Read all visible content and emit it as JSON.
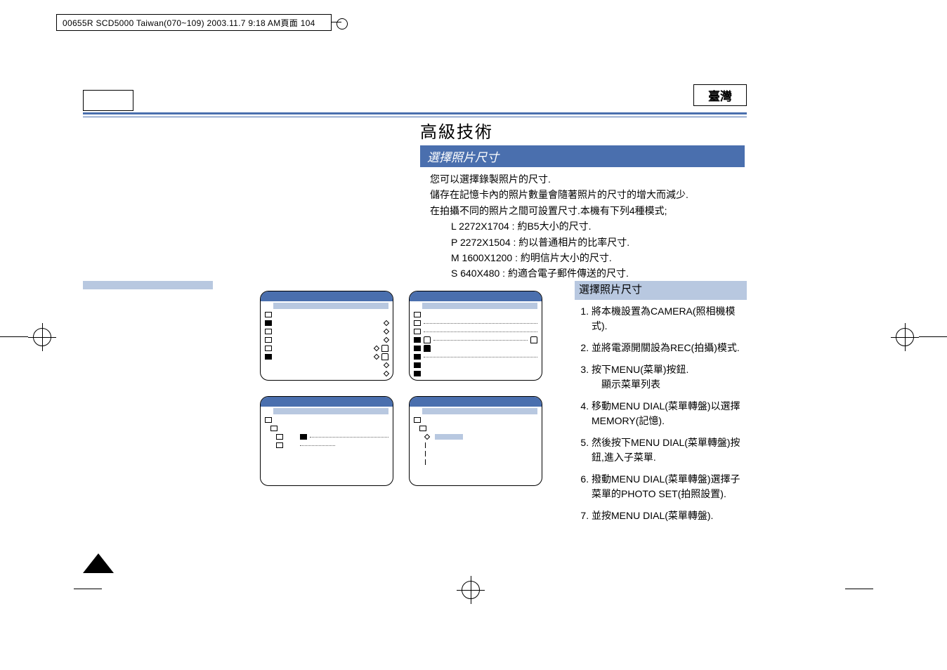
{
  "spine": "00655R SCD5000 Taiwan(070~109)  2003.11.7  9:18 AM頁面 104",
  "language_label": "臺灣",
  "heading": "高級技術",
  "section_title": "選擇照片尺寸",
  "intro": {
    "l1": "您可以選擇錄製照片的尺寸.",
    "l2": "儲存在記憶卡內的照片數量會隨著照片的尺寸的增大而減少.",
    "l3": "在拍攝不同的照片之間可設置尺寸.本機有下列4種模式;",
    "modes": {
      "L": "L 2272X1704 : 約B5大小的尺寸.",
      "P": "P 2272X1504 : 約以普通相片的比率尺寸.",
      "M": "M 1600X1200 : 約明信片大小的尺寸.",
      "S": "S 640X480 : 約適合電子郵件傳送的尺寸."
    }
  },
  "steps_title": "選擇照片尺寸",
  "steps": [
    "將本機設置為CAMERA(照相機模式).",
    "並將電源開關設為REC(拍攝)模式.",
    "按下MENU(菜單)按鈕.",
    "移動MENU DIAL(菜單轉盤)以選擇MEMORY(記憶).",
    "然後按下MENU DIAL(菜單轉盤)按鈕,進入子菜單.",
    "撥動MENU DIAL(菜單轉盤)選擇子菜單的PHOTO SET(拍照設置).",
    "並按MENU DIAL(菜單轉盤)."
  ],
  "step3_sub": "顯示菜單列表"
}
